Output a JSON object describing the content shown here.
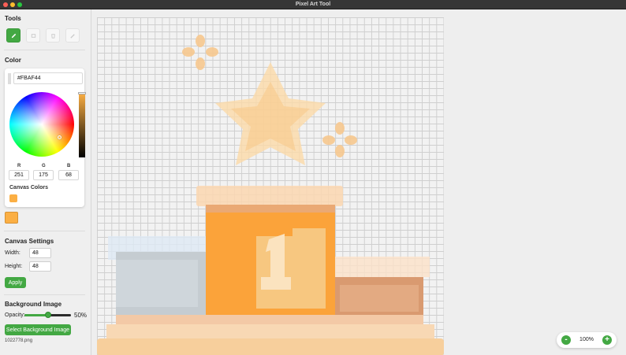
{
  "window": {
    "title": "Pixel Art Tool"
  },
  "tools": {
    "title": "Tools",
    "items": [
      {
        "name": "pencil",
        "icon": "pencil-icon",
        "active": true
      },
      {
        "name": "eraser",
        "icon": "eraser-icon",
        "active": false
      },
      {
        "name": "fill",
        "icon": "bucket-icon",
        "active": false
      },
      {
        "name": "eyedropper",
        "icon": "eyedropper-icon",
        "active": false
      }
    ]
  },
  "color": {
    "title": "Color",
    "hex": "#FBAF44",
    "r_label": "R",
    "g_label": "G",
    "b_label": "B",
    "r": "251",
    "g": "175",
    "b": "68",
    "canvas_colors_title": "Canvas Colors",
    "current": "#fbaf44"
  },
  "canvas_settings": {
    "title": "Canvas Settings",
    "width_label": "Width:",
    "width": "48",
    "height_label": "Height:",
    "height": "48",
    "apply_label": "Apply"
  },
  "background_image": {
    "title": "Background Image",
    "opacity_label": "Opacity:",
    "opacity": 0.5,
    "opacity_text": "50%",
    "select_label": "Select Background Image",
    "filename": "1022778.png"
  },
  "zoom": {
    "minus": "-",
    "plus": "+",
    "value": "100%"
  },
  "colors": {
    "accent": "#43a843",
    "gold": "#fbaf44"
  }
}
